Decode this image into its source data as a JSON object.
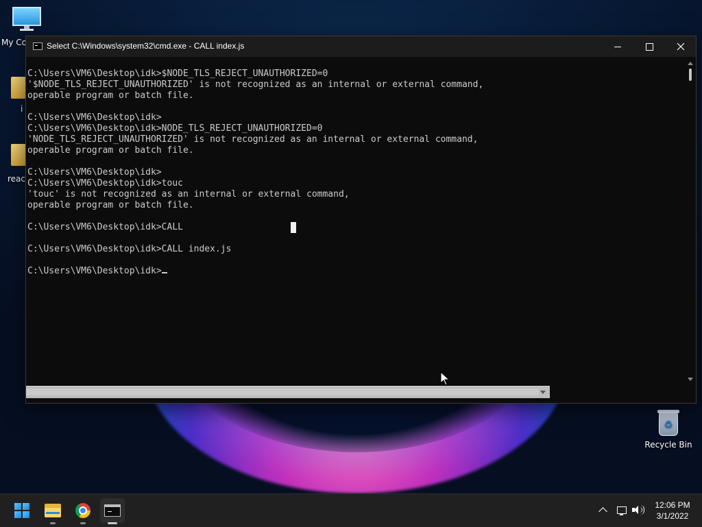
{
  "desktop": {
    "icons": [
      {
        "name": "my-computer",
        "label": "My Co"
      },
      {
        "name": "folder-idk",
        "label": "i"
      },
      {
        "name": "folder-react",
        "label": "react"
      }
    ],
    "recycle_bin": {
      "label": "Recycle Bin"
    }
  },
  "window": {
    "title": "Select C:\\Windows\\system32\\cmd.exe  - CALL  index.js",
    "buttons": {
      "minimize": "minimize",
      "maximize": "maximize",
      "close": "close"
    }
  },
  "console": {
    "lines": [
      "C:\\Users\\VM6\\Desktop\\idk>$NODE_TLS_REJECT_UNAUTHORIZED=0",
      "'$NODE_TLS_REJECT_UNAUTHORIZED' is not recognized as an internal or external command,",
      "operable program or batch file.",
      "",
      "C:\\Users\\VM6\\Desktop\\idk>",
      "C:\\Users\\VM6\\Desktop\\idk>NODE_TLS_REJECT_UNAUTHORIZED=0",
      "'NODE_TLS_REJECT_UNAUTHORIZED' is not recognized as an internal or external command,",
      "operable program or batch file.",
      "",
      "C:\\Users\\VM6\\Desktop\\idk>",
      "C:\\Users\\VM6\\Desktop\\idk>touc",
      "'touc' is not recognized as an internal or external command,",
      "operable program or batch file.",
      "",
      "C:\\Users\\VM6\\Desktop\\idk>CALL",
      "",
      "C:\\Users\\VM6\\Desktop\\idk>CALL index.js",
      "",
      "C:\\Users\\VM6\\Desktop\\idk>"
    ]
  },
  "taskbar": {
    "apps": [
      {
        "name": "start",
        "label": "Start"
      },
      {
        "name": "file-explorer",
        "label": "File Explorer"
      },
      {
        "name": "chrome",
        "label": "Google Chrome"
      },
      {
        "name": "command-prompt",
        "label": "Command Prompt",
        "active": true
      }
    ],
    "clock": {
      "time": "12:06 PM",
      "date": "3/1/2022"
    }
  },
  "colors": {
    "console_bg": "#0c0c0c",
    "console_text": "#cccccc",
    "titlebar_bg": "#1c1c1c",
    "taskbar_bg": "#202020"
  }
}
